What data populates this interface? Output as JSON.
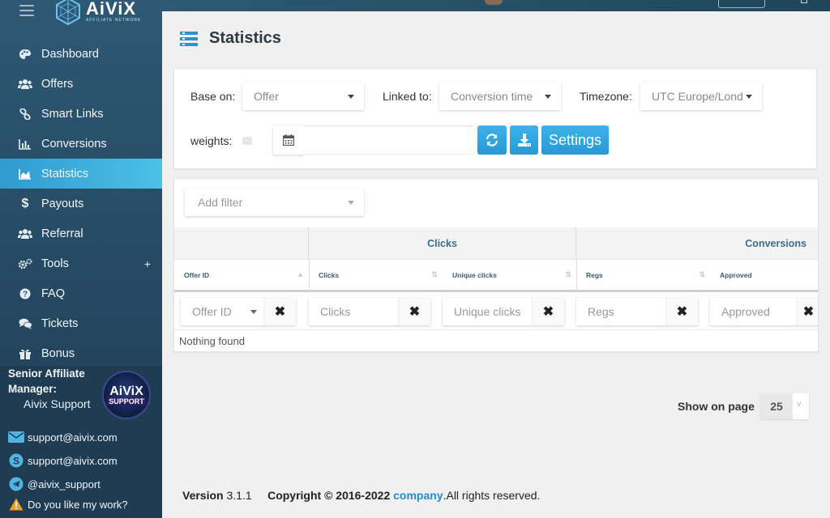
{
  "app": {
    "logo_name": "AiViX",
    "logo_sub": "AFFILIATE NETWORK"
  },
  "sidebar": {
    "items": [
      {
        "label": "Dashboard",
        "icon": "palette-icon"
      },
      {
        "label": "Offers",
        "icon": "users-icon"
      },
      {
        "label": "Smart Links",
        "icon": "link-icon"
      },
      {
        "label": "Conversions",
        "icon": "bar-chart-icon"
      },
      {
        "label": "Statistics",
        "icon": "area-chart-icon",
        "active": true
      },
      {
        "label": "Payouts",
        "icon": "dollar-icon"
      },
      {
        "label": "Referral",
        "icon": "users-icon"
      },
      {
        "label": "Tools",
        "icon": "cogs-icon",
        "expand": "+"
      },
      {
        "label": "FAQ",
        "icon": "question-icon"
      },
      {
        "label": "Tickets",
        "icon": "comments-icon"
      },
      {
        "label": "Bonus",
        "icon": "gift-icon"
      }
    ]
  },
  "manager": {
    "label_line1": "Senior Affiliate",
    "label_line2": "Manager:",
    "name": "Aivix Support",
    "badge_top": "AiViX",
    "badge_bottom": "SUPPORT",
    "email": "support@aivix.com",
    "skype": "support@aivix.com",
    "telegram": "@aivix_support",
    "feedback": "Do you like my work?"
  },
  "page": {
    "title": "Statistics"
  },
  "filters": {
    "base_on_label": "Base on:",
    "base_on_value": "Offer",
    "linked_to_label": "Linked to:",
    "linked_to_value": "Conversion time",
    "timezone_label": "Timezone:",
    "timezone_value": "UTC Europe/Lond",
    "weights_label": "weights:",
    "settings_label": "Settings"
  },
  "table": {
    "add_filter_placeholder": "Add filter",
    "groups": {
      "clicks": "Clicks",
      "conversions": "Conversions"
    },
    "columns": {
      "offer_id": "Offer ID",
      "clicks": "Clicks",
      "unique_clicks": "Unique clicks",
      "regs": "Regs",
      "approved": "Approved"
    },
    "filter_placeholders": {
      "offer_id": "Offer ID",
      "clicks": "Clicks",
      "unique_clicks": "Unique clicks",
      "regs": "Regs",
      "approved": "Approved"
    },
    "empty_text": "Nothing found"
  },
  "pagination": {
    "show_label": "Show on page",
    "page_size": "25"
  },
  "footer": {
    "version_label": "Version",
    "version": "3.1.1",
    "copyright": "Copyright © 2016-2022",
    "company": "company",
    "rights": ".All rights reserved."
  },
  "colors": {
    "sidebar": "#2e5874",
    "active": "#3ea7d6",
    "accent": "#2699d6",
    "link": "#1e8fd0"
  }
}
